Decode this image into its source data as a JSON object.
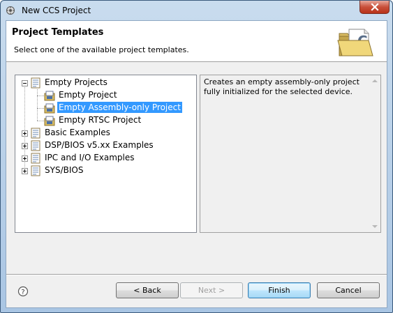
{
  "window": {
    "title": "New CCS Project",
    "close_symbol": "×"
  },
  "header": {
    "title": "Project Templates",
    "description": "Select one of the available project templates.",
    "icon": "ccs-folder-icon"
  },
  "tree": {
    "items": [
      {
        "label": "Empty Projects",
        "level": 0,
        "expanded": true,
        "icon": "template-group-icon"
      },
      {
        "label": "Empty Project",
        "level": 1,
        "icon": "project-icon"
      },
      {
        "label": "Empty Assembly-only Project",
        "level": 1,
        "icon": "project-icon",
        "selected": true
      },
      {
        "label": "Empty RTSC Project",
        "level": 1,
        "icon": "project-icon"
      },
      {
        "label": "Basic Examples",
        "level": 0,
        "expanded": false,
        "icon": "template-group-icon"
      },
      {
        "label": "DSP/BIOS v5.xx Examples",
        "level": 0,
        "expanded": false,
        "icon": "template-group-icon"
      },
      {
        "label": "IPC and I/O Examples",
        "level": 0,
        "expanded": false,
        "icon": "template-group-icon"
      },
      {
        "label": "SYS/BIOS",
        "level": 0,
        "expanded": false,
        "icon": "template-group-icon"
      }
    ]
  },
  "description_panel": {
    "text": "Creates an empty assembly-only project fully initialized for the selected device."
  },
  "footer": {
    "help_icon": "help-icon",
    "back_label": "< Back",
    "next_label": "Next >",
    "finish_label": "Finish",
    "cancel_label": "Cancel"
  },
  "colors": {
    "selection": "#3399ff",
    "titlebar": "#c9dcee",
    "close_button": "#c9503a"
  }
}
